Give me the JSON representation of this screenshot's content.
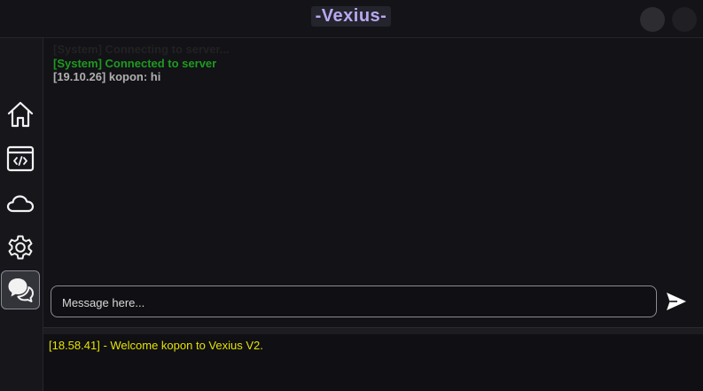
{
  "window": {
    "title": "-Vexius-"
  },
  "sidebar": {
    "items": [
      {
        "name": "home",
        "icon": "home-icon"
      },
      {
        "name": "editor",
        "icon": "code-window-icon"
      },
      {
        "name": "cloud",
        "icon": "cloud-icon"
      },
      {
        "name": "settings",
        "icon": "gear-icon"
      },
      {
        "name": "chat",
        "icon": "chat-bubbles-icon",
        "active": true
      }
    ]
  },
  "chat": {
    "messages": [
      {
        "text": "[System] Connecting to server...",
        "color": "#222222"
      },
      {
        "text": "[System] Connected to server",
        "color": "#1f9a1f"
      },
      {
        "text": "[19.10.26] kopon: hi",
        "color": "#b0b0b0"
      }
    ],
    "input": {
      "placeholder": "Message here...",
      "value": ""
    },
    "send_icon": "send-icon"
  },
  "console": {
    "line": "[18.58.41] - Welcome kopon to Vexius V2.",
    "color": "#e5e300"
  },
  "colors": {
    "accent_title": "#b9a8f0",
    "background": "#141419"
  }
}
